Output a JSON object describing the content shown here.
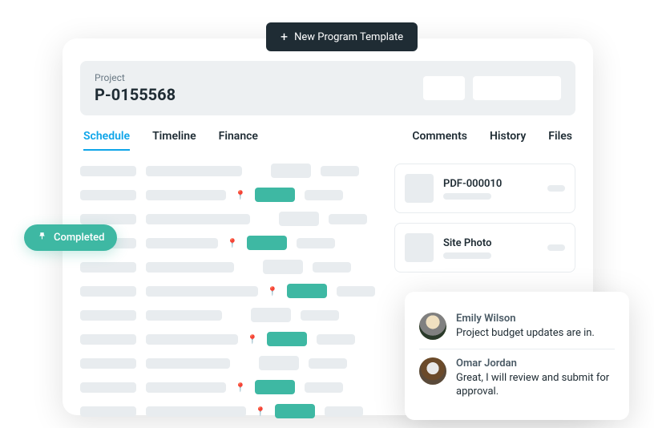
{
  "top_button": {
    "label": "New Program Template"
  },
  "project": {
    "label": "Project",
    "id": "P-0155568"
  },
  "tabs_left": [
    {
      "label": "Schedule",
      "active": true
    },
    {
      "label": "Timeline"
    },
    {
      "label": "Finance"
    }
  ],
  "tabs_right": [
    {
      "label": "Comments"
    },
    {
      "label": "History"
    },
    {
      "label": "Files"
    }
  ],
  "files": [
    {
      "name": "PDF-000010"
    },
    {
      "name": "Site Photo"
    }
  ],
  "completed_pill": {
    "label": "Completed"
  },
  "comments": [
    {
      "name": "Emily Wilson",
      "text": "Project budget updates are in."
    },
    {
      "name": "Omar Jordan",
      "text": "Great, I will review and submit for approval."
    }
  ]
}
